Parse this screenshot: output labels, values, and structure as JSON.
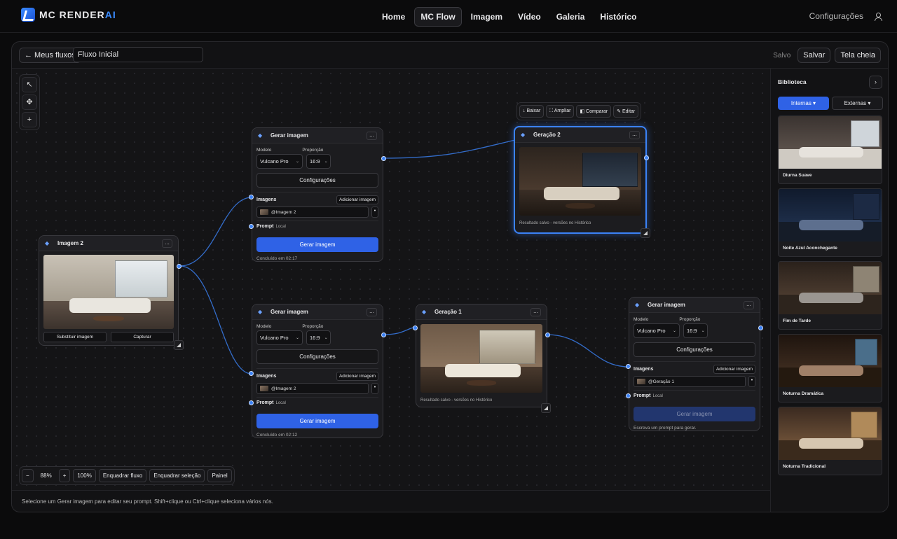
{
  "brand": {
    "name_a": "MC",
    "name_b": "RENDER",
    "name_c": "AI"
  },
  "nav": {
    "items": [
      "Home",
      "MC Flow",
      "Imagem",
      "Vídeo",
      "Galeria",
      "Histórico"
    ],
    "active": "MC Flow"
  },
  "top_right": {
    "settings": "Configurações"
  },
  "header": {
    "back": "← Meus fluxos",
    "flow_name": "Fluxo Inicial",
    "saved": "Salvo",
    "save": "Salvar",
    "fullscreen": "Tela cheia"
  },
  "tools": {
    "select": "↖",
    "pan": "✥",
    "add": "+"
  },
  "zoom": {
    "minus": "−",
    "level": "88%",
    "plus": "+",
    "reset": "100%",
    "fit_flow": "Enquadrar fluxo",
    "fit_selection": "Enquadrar seleção",
    "panel": "Painel"
  },
  "status": "Selecione um Gerar imagem para editar seu prompt. Shift+clique ou Ctrl+clique seleciona vários nós.",
  "image_actions": [
    "↓ Baixar",
    "⛶ Ampliar",
    "◧ Comparar",
    "✎ Editar"
  ],
  "node_image2": {
    "title": "Imagem 2",
    "more": "...",
    "replace": "Substituir imagem",
    "capture": "Capturar"
  },
  "gen_nodes": [
    {
      "title": "Gerar imagem",
      "more": "...",
      "model_label": "Modelo",
      "ratio_label": "Proporção",
      "model": "Vulcano Pro",
      "ratio": "16:9",
      "settings": "Configurações",
      "images_label": "Imagens",
      "add_image": "Adicionar imagem",
      "image_ref": "@Imagem 2",
      "prompt_label": "Prompt",
      "prompt_local": "Local",
      "generate": "Gerar imagem",
      "footer": "Concluído em 02:17"
    },
    {
      "title": "Gerar imagem",
      "more": "...",
      "model_label": "Modelo",
      "ratio_label": "Proporção",
      "model": "Vulcano Pro",
      "ratio": "16:9",
      "settings": "Configurações",
      "images_label": "Imagens",
      "add_image": "Adicionar imagem",
      "image_ref": "@Imagem 2",
      "prompt_label": "Prompt",
      "prompt_local": "Local",
      "generate": "Gerar imagem",
      "footer": "Concluído em 02:12"
    },
    {
      "title": "Gerar imagem",
      "more": "...",
      "model_label": "Modelo",
      "ratio_label": "Proporção",
      "model": "Vulcano Pro",
      "ratio": "16:9",
      "settings": "Configurações",
      "images_label": "Imagens",
      "add_image": "Adicionar imagem",
      "image_ref": "@Geração 1",
      "prompt_label": "Prompt",
      "prompt_local": "Local",
      "generate": "Gerar imagem",
      "footer": "Escreva um prompt para gerar."
    }
  ],
  "result_nodes": [
    {
      "title": "Geração 2",
      "more": "...",
      "footer": "Resultado salvo - versões no Histórico"
    },
    {
      "title": "Geração 1",
      "more": "...",
      "footer": "Resultado salvo - versões no Histórico"
    }
  ],
  "library": {
    "title": "Biblioteca",
    "toggle": "›",
    "tabs": [
      "Internas ▾",
      "Externas ▾"
    ],
    "items": [
      "Diurna Suave",
      "Noite Azul Aconchegante",
      "Fim de Tarde",
      "Noturna Dramática",
      "Noturna Tradicional"
    ]
  },
  "colors": {
    "accent": "#2f62e6",
    "selection": "#3b82f6",
    "background": "#0b0b0c"
  }
}
